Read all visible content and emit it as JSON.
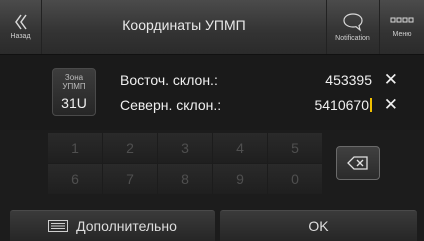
{
  "header": {
    "back_label": "Назад",
    "title": "Координаты УПМП",
    "notification_label": "Notification",
    "menu_label": "Меню"
  },
  "zone": {
    "label": "Зона\nУПМП",
    "value": "31U"
  },
  "easting": {
    "label": "Восточ. склон.:",
    "value": "453395"
  },
  "northing": {
    "label": "Северн. склон.:",
    "value": "5410670"
  },
  "keypad": {
    "keys": [
      "1",
      "2",
      "3",
      "4",
      "5",
      "6",
      "7",
      "8",
      "9",
      "0"
    ]
  },
  "footer": {
    "more_label": "Дополнительно",
    "ok_label": "OK"
  },
  "colors": {
    "caret": "#f0c000",
    "background": "#1c1c1c"
  },
  "icons": [
    "back-chevron-icon",
    "speech-bubble-icon",
    "menu-grid-icon",
    "clear-icon",
    "backspace-icon",
    "list-icon"
  ]
}
